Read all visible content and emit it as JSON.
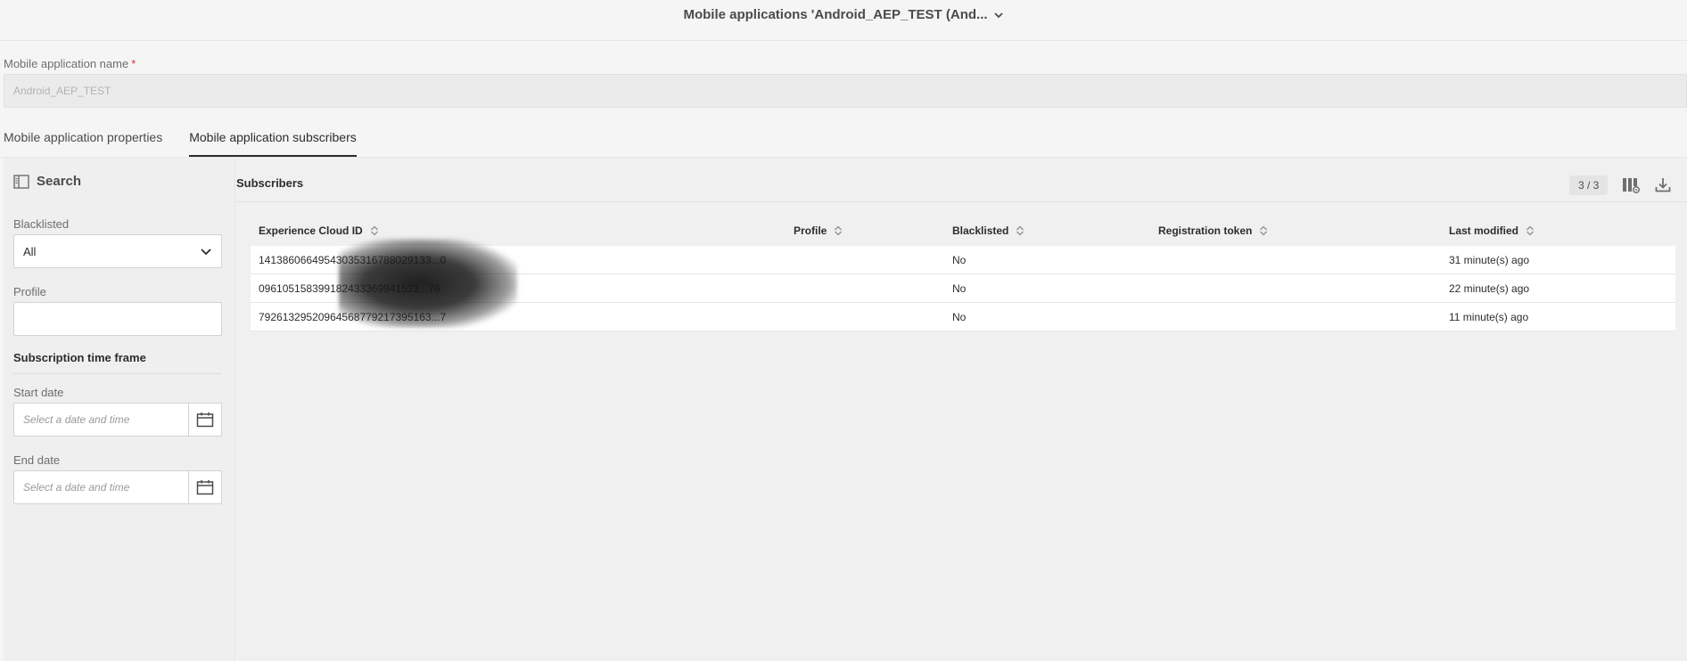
{
  "header": {
    "title": "Mobile applications 'Android_AEP_TEST (And..."
  },
  "form": {
    "name_label": "Mobile application name",
    "required_mark": "*",
    "name_value": "Android_AEP_TEST"
  },
  "tabs": [
    {
      "label": "Mobile application properties",
      "active": false
    },
    {
      "label": "Mobile application subscribers",
      "active": true
    }
  ],
  "filters": {
    "title": "Search",
    "blacklisted_label": "Blacklisted",
    "blacklisted_value": "All",
    "profile_label": "Profile",
    "profile_value": "",
    "time_frame_title": "Subscription time frame",
    "start_label": "Start date",
    "start_placeholder": "Select a date and time",
    "end_label": "End date",
    "end_placeholder": "Select a date and time"
  },
  "subscribers": {
    "title": "Subscribers",
    "count": "3 / 3",
    "columns": [
      "Experience Cloud ID",
      "Profile",
      "Blacklisted",
      "Registration token",
      "Last modified"
    ],
    "rows": [
      {
        "ecid": "14138606649543035316788029133...0",
        "profile": "",
        "blacklisted": "No",
        "token": "",
        "modified": "31 minute(s) ago"
      },
      {
        "ecid": "096105158399182433369941521...76",
        "profile": "",
        "blacklisted": "No",
        "token": "",
        "modified": "22 minute(s) ago"
      },
      {
        "ecid": "79261329520964568779217395163...7",
        "profile": "",
        "blacklisted": "No",
        "token": "",
        "modified": "11 minute(s) ago"
      }
    ]
  },
  "icons": {
    "chevron": "chevron-down-icon",
    "panel": "sidebar-panel-icon",
    "calendar": "calendar-icon",
    "columns": "column-settings-icon",
    "download": "download-icon",
    "sort": "sort-icon"
  }
}
